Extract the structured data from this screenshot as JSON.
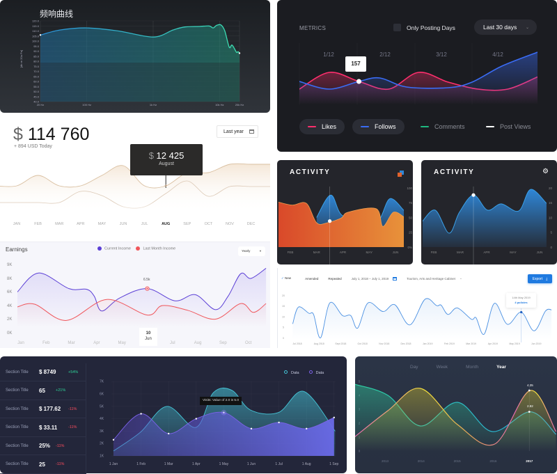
{
  "freq_panel": {
    "title": "频响曲线"
  },
  "metrics_panel": {
    "label": "METRICS",
    "checkbox_label": "Only Posting Days",
    "range_select": "Last 30 days",
    "tooltip": "157",
    "legend": [
      {
        "label": "Likes",
        "color": "#ff2f6d",
        "active": true
      },
      {
        "label": "Follows",
        "color": "#3a6cf5",
        "active": true
      },
      {
        "label": "Comments",
        "color": "#1fb980",
        "active": false
      },
      {
        "label": "Post Views",
        "color": "#ffffff",
        "active": false
      }
    ]
  },
  "revenue_panel": {
    "currency": "$",
    "total": "114 760",
    "today": "+ 894 USD Today",
    "period_button": "Last year",
    "tooltip_currency": "$",
    "tooltip_value": "12 425",
    "tooltip_month": "August"
  },
  "earnings_panel": {
    "title": "Earnings",
    "legend": [
      {
        "label": "Current Income",
        "color": "#5b3fd6"
      },
      {
        "label": "Last Month Income",
        "color": "#f0565b"
      }
    ],
    "period_select": "Yearly",
    "point_label": "6.5k",
    "selected_day": "10",
    "selected_month": "Jun"
  },
  "activity_panels": [
    {
      "title": "ACTIVITY",
      "icon": "layers-icon"
    },
    {
      "title": "ACTIVITY",
      "icon": "gear-icon"
    }
  ],
  "policies_panel": {
    "filters": [
      {
        "label": "New",
        "checked": true
      },
      {
        "label": "Amended",
        "checked": false
      },
      {
        "label": "Repealed",
        "checked": false
      }
    ],
    "date_range": "July 1, 2018 – July 1, 2019",
    "department": "Tourism, Arts and Heritage Cabinet",
    "export_button": "Export",
    "tooltip_date": "14th May 2019",
    "tooltip_value": "4 policies",
    "accent": "#1f7ae0"
  },
  "visits_panel": {
    "stats": [
      {
        "label": "Section Title",
        "value": "$ 8749",
        "change": "+54%",
        "trend": "up"
      },
      {
        "label": "Section Title",
        "value": "65",
        "change": "+21%",
        "trend": "up"
      },
      {
        "label": "Section Title",
        "value": "$ 177.62",
        "change": "-11%",
        "trend": "down"
      },
      {
        "label": "Section Title",
        "value": "$ 33.11",
        "change": "-11%",
        "trend": "down"
      },
      {
        "label": "Section Title",
        "value": "25%",
        "change": "-11%",
        "trend": "down"
      },
      {
        "label": "Section Title",
        "value": "25",
        "change": "-11%",
        "trend": "down"
      }
    ],
    "tooltip": "Visits: Value of 2.0 is 5.0"
  },
  "yearly_panel": {
    "tabs": [
      "Day",
      "Week",
      "Month",
      "Year"
    ],
    "active_tab": "Year",
    "labels": [
      "4.35",
      "2.82"
    ]
  },
  "chart_data": [
    {
      "type": "area",
      "title": "频响曲线",
      "ylabel": "[db re 20u Pa]",
      "x_scale": "log",
      "yticks": [
        "120.0",
        "115.0",
        "110.0",
        "105.0",
        "100.0",
        "95.0",
        "90.0",
        "85.0",
        "80.0",
        "75.0",
        "70.0",
        "65.0",
        "60.0",
        "55.0",
        "50.0",
        "45.0",
        "40.0"
      ],
      "xticks": [
        "20 Hz",
        "100 Hz",
        "1k Hz",
        "10k Hz",
        "20k Hz"
      ],
      "xtick_values": [
        20,
        100,
        1000,
        10000,
        20000
      ],
      "ylim": [
        40,
        120
      ],
      "grid": true,
      "series": [
        {
          "color_start": "#2a8fd8",
          "color_end": "#3de0b0",
          "points": [
            [
              20,
              106
            ],
            [
              40,
              111
            ],
            [
              100,
              113
            ],
            [
              300,
              110
            ],
            [
              1000,
              104
            ],
            [
              2000,
              111
            ],
            [
              3000,
              114
            ],
            [
              5000,
              114.5
            ],
            [
              7000,
              115
            ],
            [
              8000,
              113
            ],
            [
              9000,
              115.5
            ],
            [
              10500,
              116
            ],
            [
              12000,
              110
            ],
            [
              14000,
              94
            ],
            [
              15500,
              96
            ],
            [
              18000,
              89
            ],
            [
              19000,
              89.5
            ],
            [
              20000,
              88
            ]
          ]
        }
      ]
    },
    {
      "type": "line",
      "xticks": [
        "1/12",
        "2/12",
        "3/12",
        "4/12"
      ],
      "series": [
        {
          "name": "Likes",
          "color": "#ff2f6d",
          "points": [
            [
              0,
              135
            ],
            [
              1,
              183
            ],
            [
              2,
              157
            ],
            [
              3,
              135
            ],
            [
              4,
              183
            ],
            [
              5,
              155
            ],
            [
              6,
              135
            ],
            [
              7,
              135
            ],
            [
              8,
              170
            ]
          ]
        },
        {
          "name": "Follows",
          "color": "#3a6cf5",
          "points": [
            [
              0,
              157
            ],
            [
              1,
              135
            ],
            [
              2,
              157
            ],
            [
              2.7,
              167
            ],
            [
              3.6,
              141
            ],
            [
              5,
              139
            ],
            [
              5.8,
              155
            ],
            [
              6.8,
              201
            ],
            [
              8,
              241
            ]
          ]
        }
      ],
      "highlight": {
        "series": "Likes",
        "x": 2,
        "value": 157
      }
    },
    {
      "type": "area",
      "xticks": [
        "JAN",
        "FEB",
        "MAR",
        "APR",
        "MAY",
        "JUN",
        "JUL",
        "AUG",
        "SEP",
        "OCT",
        "NOV",
        "DEC"
      ],
      "active_tick": "AUG",
      "series": [
        {
          "values": [
            12425,
            16175,
            12425,
            12425,
            16175,
            19675,
            12425,
            12425,
            17175,
            17175,
            20175,
            20175
          ]
        },
        {
          "values": [
            6425,
            6425,
            6425,
            10425,
            8925,
            4925,
            4925,
            9675,
            14175,
            8675,
            12175,
            12175
          ]
        }
      ],
      "highlight": {
        "month": "August",
        "value": 12425
      }
    },
    {
      "type": "line",
      "xticks": [
        "Jan",
        "Feb",
        "Mar",
        "Apr",
        "May",
        "Jun",
        "Jul",
        "Aug",
        "Sep",
        "Oct"
      ],
      "yticks": [
        "9K",
        "8K",
        "6K",
        "4K",
        "2K",
        "0K"
      ],
      "unit": "K",
      "series": [
        {
          "name": "Current Income",
          "color": "#5b3fd6",
          "points": [
            [
              -0.14,
              6.0
            ],
            [
              0.7,
              8.8
            ],
            [
              1.9,
              6.5
            ],
            [
              2.6,
              6.4
            ],
            [
              2.9,
              5.4
            ],
            [
              3.2,
              3.2
            ],
            [
              3.9,
              5.1
            ],
            [
              5.0,
              6.5
            ],
            [
              6.1,
              4.7
            ],
            [
              6.9,
              5.6
            ],
            [
              7.7,
              3.4
            ],
            [
              8.2,
              5.4
            ],
            [
              8.7,
              8.7
            ],
            [
              9.1,
              8.0
            ],
            [
              9.7,
              9.5
            ]
          ]
        },
        {
          "name": "Last Month Income",
          "color": "#f0565b",
          "points": [
            [
              -0.14,
              3.8
            ],
            [
              0.55,
              4.2
            ],
            [
              1.8,
              1.8
            ],
            [
              3.4,
              4.9
            ],
            [
              5.0,
              2.6
            ],
            [
              5.6,
              4.0
            ],
            [
              6.6,
              3.3
            ],
            [
              7.7,
              2.0
            ],
            [
              8.7,
              4.3
            ],
            [
              9.2,
              3.0
            ],
            [
              9.7,
              4.3
            ]
          ]
        }
      ],
      "highlight": {
        "series": "Current Income",
        "x": 5.0,
        "label": "6.5k"
      }
    },
    {
      "type": "area",
      "xticks": [
        "FEB",
        "MAR",
        "APR",
        "MAY",
        "JUN"
      ],
      "yticks": [
        "100",
        "75",
        "50",
        "25",
        "0%"
      ],
      "ylim": [
        0,
        100
      ],
      "series": [
        {
          "color": "#e0622c",
          "points": [
            [
              -0.45,
              76
            ],
            [
              0.08,
              71
            ],
            [
              0.61,
              74
            ],
            [
              1.0,
              41
            ],
            [
              1.4,
              41
            ],
            [
              1.93,
              49
            ],
            [
              2.2,
              59
            ],
            [
              3.26,
              65
            ],
            [
              3.52,
              35
            ],
            [
              3.92,
              59
            ],
            [
              4.32,
              51
            ]
          ]
        },
        {
          "color": "#2f86d6",
          "points": [
            [
              1.0,
              50
            ],
            [
              1.54,
              88
            ],
            [
              1.99,
              53
            ],
            [
              2.99,
              50
            ],
            [
              3.39,
              47
            ],
            [
              3.79,
              82
            ],
            [
              4.32,
              62
            ]
          ]
        }
      ],
      "highlight": {
        "x": 1.5,
        "value": 44
      }
    },
    {
      "type": "area",
      "xticks": [
        "FEB",
        "MAR",
        "APR",
        "MAY",
        "JUN"
      ],
      "yticks": [
        "20",
        "15",
        "10",
        "5",
        "0"
      ],
      "ylim": [
        0,
        20
      ],
      "series": [
        {
          "color": "#2f86d6",
          "points": [
            [
              -0.47,
              8.2
            ],
            [
              0.05,
              12.5
            ],
            [
              0.58,
              4.7
            ],
            [
              0.97,
              11.8
            ],
            [
              1.5,
              17.6
            ],
            [
              2.03,
              12.5
            ],
            [
              2.55,
              14.6
            ],
            [
              3.21,
              12.2
            ],
            [
              3.66,
              19.5
            ],
            [
              4.26,
              14.8
            ]
          ]
        }
      ],
      "highlight": {
        "x": 1.5,
        "value": 17.6
      }
    },
    {
      "type": "area",
      "xticks": [
        "Jul 2018",
        "Aug 2018",
        "Sept 2018",
        "Oct 2018",
        "Nov 2018",
        "Dec 2018",
        "Jan 2019",
        "Feb 2019",
        "Mar 2019",
        "Apr 2019",
        "May 2019",
        "Jun 2019"
      ],
      "yticks": [
        "20",
        "15",
        "10",
        "5",
        "0"
      ],
      "ylim": [
        0,
        20
      ],
      "series": [
        {
          "color": "#4a90e2",
          "points": [
            [
              -0.21,
              6.8
            ],
            [
              0.05,
              14.7
            ],
            [
              0.53,
              11.8
            ],
            [
              0.75,
              11.2
            ],
            [
              1.07,
              0.2
            ],
            [
              1.5,
              16.7
            ],
            [
              2.08,
              10.7
            ],
            [
              2.46,
              10.7
            ],
            [
              2.78,
              4.8
            ],
            [
              3.26,
              16.7
            ],
            [
              3.95,
              12.6
            ],
            [
              4.49,
              15.8
            ],
            [
              5.18,
              6.3
            ],
            [
              5.88,
              18.4
            ],
            [
              6.41,
              15.4
            ],
            [
              6.62,
              15.6
            ],
            [
              6.94,
              11.2
            ],
            [
              7.37,
              14.3
            ],
            [
              8.01,
              9.0
            ],
            [
              8.23,
              9.6
            ],
            [
              8.6,
              1.9
            ],
            [
              9.08,
              16.5
            ],
            [
              9.67,
              6.6
            ],
            [
              10.31,
              12.3
            ],
            [
              10.9,
              3.5
            ],
            [
              11.43,
              12.9
            ],
            [
              11.75,
              13.2
            ]
          ]
        }
      ],
      "highlight": {
        "x": 10.31,
        "date": "14th May 2019",
        "label": "4 policies"
      }
    },
    {
      "type": "area",
      "xticks": [
        "1 Jan",
        "1 Feb",
        "1 Mar",
        "1 Apr",
        "1 May",
        "1 Jun",
        "1 Jul",
        "1 Aug",
        "1 Sep"
      ],
      "yticks": [
        "7K",
        "6K",
        "5K",
        "4K",
        "3K",
        "2K",
        "1K"
      ],
      "ylim": [
        1,
        7
      ],
      "unit": "K",
      "series": [
        {
          "name": "Data",
          "color": "#45c6d8",
          "points": [
            [
              0,
              1.4
            ],
            [
              0.97,
              2.9
            ],
            [
              1.94,
              5.0
            ],
            [
              2.99,
              3.3
            ],
            [
              3.62,
              6.1
            ],
            [
              4.29,
              6.3
            ],
            [
              4.97,
              4.7
            ],
            [
              5.98,
              4.5
            ],
            [
              6.91,
              6.2
            ],
            [
              8.04,
              3.0
            ]
          ]
        },
        {
          "name": "Data",
          "color": "#7b62e8",
          "points": [
            [
              0,
              2.3
            ],
            [
              1,
              4.4
            ],
            [
              2,
              2.8
            ],
            [
              3,
              4.0
            ],
            [
              4,
              4.5
            ],
            [
              5,
              3.2
            ],
            [
              6,
              3.7
            ],
            [
              7,
              3.2
            ],
            [
              8,
              4.1
            ]
          ]
        }
      ],
      "highlight": {
        "x": 4,
        "label": "Visits: Value of 2.0 is 5.0"
      }
    },
    {
      "type": "area",
      "xticks": [
        "2013",
        "2014",
        "2015",
        "2016",
        "2017"
      ],
      "active_tick": "2017",
      "yticks": [
        "5",
        "4",
        "3",
        "2",
        "1",
        "0"
      ],
      "ylim": [
        0,
        5
      ],
      "series": [
        {
          "color": "#2ed0a0",
          "color_end": "#2aa8e0",
          "points": [
            [
              -0.85,
              4.8
            ],
            [
              0.08,
              4.0
            ],
            [
              0.98,
              1.8
            ],
            [
              2.01,
              3.5
            ],
            [
              2.97,
              1.4
            ],
            [
              4.03,
              2.82
            ],
            [
              4.74,
              1.2
            ]
          ]
        },
        {
          "color": "#f2e23a",
          "color_end": "#e86ab0",
          "points": [
            [
              -0.85,
              1.0
            ],
            [
              0.08,
              2.9
            ],
            [
              0.98,
              4.5
            ],
            [
              2.01,
              1.9
            ],
            [
              3.04,
              0.5
            ],
            [
              4.03,
              4.35
            ],
            [
              4.74,
              1.4
            ]
          ]
        }
      ],
      "highlight": {
        "x": "2017",
        "values": [
          4.35,
          2.82
        ]
      }
    }
  ]
}
